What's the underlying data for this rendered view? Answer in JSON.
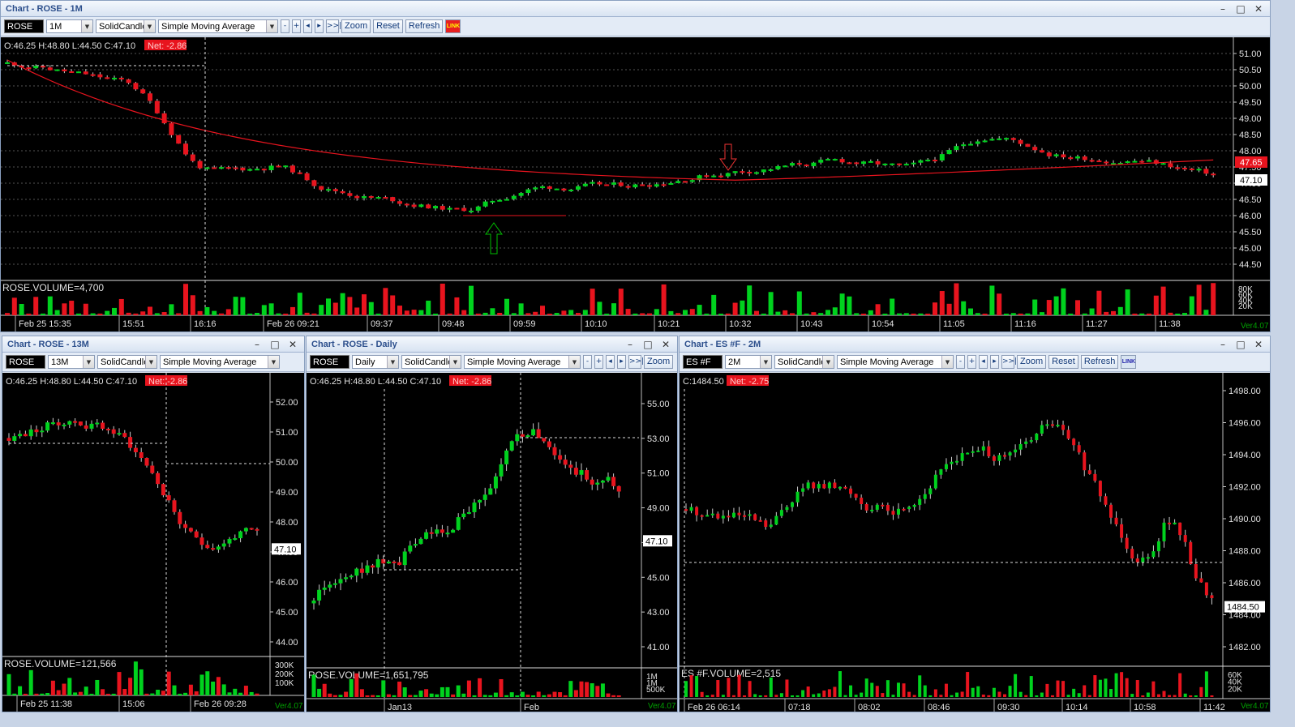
{
  "windows": [
    {
      "title": "Chart - ROSE - 1M",
      "symbol": "ROSE",
      "interval": "1M",
      "style": "SolidCandle",
      "indicator": "Simple Moving Average",
      "buttons": [
        "Zoom",
        "Reset",
        "Refresh"
      ],
      "link_icon": "link-active",
      "ohlc": "O:46.25  H:48.80  L:44.50  C:47.10",
      "net": "Net: -2.86",
      "volume_label": "ROSE.VOLUME=4,700",
      "price_ticks": [
        "51.00",
        "50.50",
        "50.00",
        "49.50",
        "49.00",
        "48.50",
        "48.00",
        "47.50",
        "47.00",
        "46.50",
        "46.00",
        "45.50",
        "45.00",
        "44.50"
      ],
      "last_price": "47.65",
      "current_price": "47.10",
      "volume_ticks": [
        "80K",
        "60K",
        "40K",
        "20K"
      ],
      "time_labels": [
        "Feb 25 15:35",
        "15:51",
        "16:16",
        "Feb 26 09:21",
        "09:37",
        "09:48",
        "09:59",
        "10:10",
        "10:21",
        "10:32",
        "10:43",
        "10:54",
        "11:05",
        "11:16",
        "11:27",
        "11:38"
      ],
      "version": "Ver4.07"
    },
    {
      "title": "Chart - ROSE - 13M",
      "symbol": "ROSE",
      "interval": "13M",
      "style": "SolidCandle",
      "indicator": "Simple Moving Average",
      "ohlc": "O:46.25  H:48.80  L:44.50  C:47.10",
      "net": "Net: -2.86",
      "volume_label": "ROSE.VOLUME=121,566",
      "price_ticks": [
        "52.00",
        "51.00",
        "50.00",
        "49.00",
        "48.00",
        "47.00",
        "46.00",
        "45.00",
        "44.00"
      ],
      "current_price": "47.10",
      "volume_ticks": [
        "300K",
        "200K",
        "100K"
      ],
      "time_labels": [
        "Feb 25 11:38",
        "15:06",
        "Feb 26 09:28"
      ],
      "version": "Ver4.07"
    },
    {
      "title": "Chart - ROSE - Daily",
      "symbol": "ROSE",
      "interval": "Daily",
      "style": "SolidCandle",
      "indicator": "Simple Moving Average",
      "buttons": [
        "Zoom"
      ],
      "ohlc": "O:46.25  H:48.80  L:44.50  C:47.10",
      "net": "Net: -2.86",
      "volume_label": "ROSE.VOLUME=1,651,795",
      "price_ticks": [
        "55.00",
        "53.00",
        "51.00",
        "49.00",
        "47.00",
        "45.00",
        "43.00",
        "41.00"
      ],
      "current_price": "47.10",
      "volume_ticks": [
        "1M",
        "1M",
        "500K"
      ],
      "time_labels": [
        "Jan13",
        "Feb"
      ],
      "version": "Ver4.07"
    },
    {
      "title": "Chart - ES #F - 2M",
      "symbol": "ES #F",
      "interval": "2M",
      "style": "SolidCandle",
      "indicator": "Simple Moving Average",
      "buttons": [
        "Zoom",
        "Reset",
        "Refresh"
      ],
      "link_icon": "link-inactive",
      "ohlc": "C:1484.50",
      "net": "Net: -2.75",
      "volume_label": "ES #F.VOLUME=2,515",
      "price_ticks": [
        "1498.00",
        "1496.00",
        "1494.00",
        "1492.00",
        "1490.00",
        "1488.00",
        "1486.00",
        "1484.00",
        "1482.00"
      ],
      "current_price": "1484.50",
      "volume_ticks": [
        "60K",
        "40K",
        "20K"
      ],
      "time_labels": [
        "Feb 26 06:14",
        "07:18",
        "08:02",
        "08:46",
        "09:30",
        "10:14",
        "10:58",
        "11:42"
      ],
      "version": "Ver4.07"
    }
  ],
  "colors": {
    "up": "#00d21e",
    "down": "#e8141e",
    "sma": "#e8141e",
    "background": "#000000",
    "net_badge": "#e8141e",
    "version_text": "#00a000"
  }
}
